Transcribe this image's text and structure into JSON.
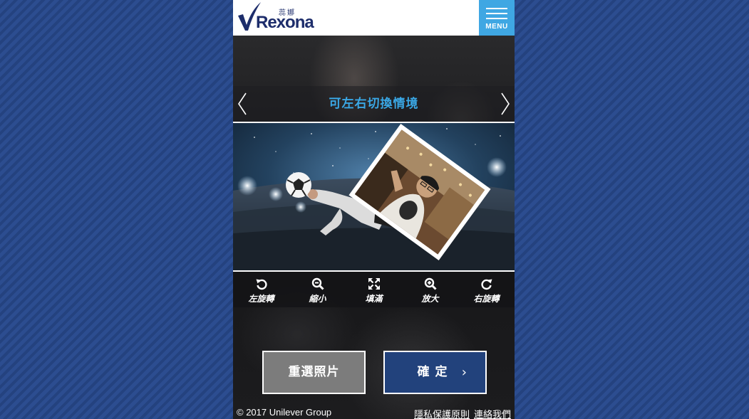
{
  "header": {
    "logo": {
      "chinese": "蕊娜",
      "brand": "Rexona",
      "icon": "check-mark-icon"
    },
    "menu": {
      "label": "MENU",
      "icon": "hamburger-icon"
    }
  },
  "scene": {
    "title": "可左右切換情境",
    "prev_icon": "chevron-left-icon",
    "next_icon": "chevron-right-icon"
  },
  "toolbar": {
    "items": [
      {
        "label": "左旋轉",
        "icon": "rotate-left-icon"
      },
      {
        "label": "縮小",
        "icon": "zoom-out-icon"
      },
      {
        "label": "填滿",
        "icon": "expand-icon"
      },
      {
        "label": "放大",
        "icon": "zoom-in-icon"
      },
      {
        "label": "右旋轉",
        "icon": "rotate-right-icon"
      }
    ]
  },
  "actions": {
    "reselect_label": "重選照片",
    "confirm_label": "確定",
    "confirm_icon": "chevron-right-icon"
  },
  "footer": {
    "copyright": "© 2017 Unilever Group",
    "privacy_link": "隱私保護原則",
    "contact_link": "連絡我們"
  },
  "colors": {
    "page_background": "#2a4a8c",
    "menu_accent": "#3fa7e3",
    "scene_title": "#3aa8e6",
    "confirm_button": "#22427c",
    "reselect_button": "#7c7c7c",
    "brand_navy": "#1d2d6b"
  }
}
